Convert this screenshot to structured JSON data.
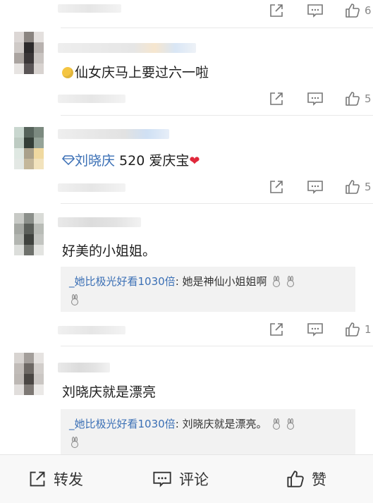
{
  "comments": [
    {
      "text": "仙女庆马上要过六一啦",
      "likes": "5"
    },
    {
      "vip_name": "刘晓庆",
      "text": " 520 爱庆宝",
      "likes": "5"
    },
    {
      "text": "好美的小姐姐。",
      "reply_user": "_她比极光好看1030倍",
      "reply_text": ": 她是神仙小姐姐啊",
      "likes": "1"
    },
    {
      "text": "刘晓庆就是漂亮",
      "reply_user": "_她比极光好看1030倍",
      "reply_text": ": 刘晓庆就是漂亮。"
    }
  ],
  "top_likes": "6",
  "bottom_bar": {
    "repost": "转发",
    "comment": "评论",
    "like": "赞"
  },
  "colors": {
    "link": "#3a6fb5",
    "heart": "#e0283b",
    "icon": "#777777"
  },
  "icons": [
    "share-icon",
    "comment-icon",
    "thumbs-up-icon",
    "heart-icon",
    "diamond-icon",
    "emoji-icon",
    "rabbit-emoji-icon"
  ]
}
